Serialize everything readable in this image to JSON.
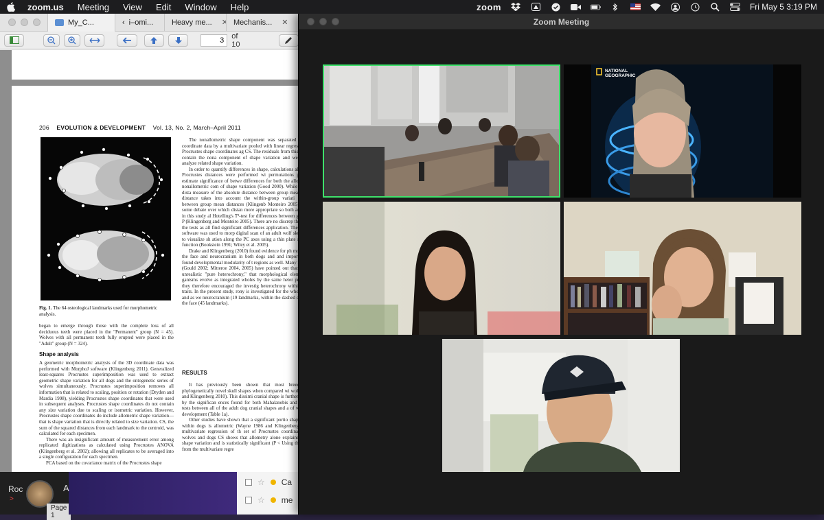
{
  "menubar": {
    "app": "zoom.us",
    "items": [
      "Meeting",
      "View",
      "Edit",
      "Window",
      "Help"
    ],
    "zoom_status": "zoom",
    "datetime": "Fri May 5  3:19 PM"
  },
  "pdf_viewer": {
    "tabs": [
      {
        "label": "My_C..."
      },
      {
        "label": "i–omi..."
      },
      {
        "label": "Heavy me..."
      },
      {
        "label": "Mechanis..."
      }
    ],
    "page_current": "3",
    "page_total_label": "of 10",
    "page": {
      "header_number": "206",
      "header_journal": "EVOLUTION & DEVELOPMENT",
      "header_issue": "Vol. 13, No. 2, March–April 2011",
      "figure_caption_bold": "Fig. 1.",
      "figure_caption": "The 64 osteological landmarks used for morphometric analysis.",
      "left_text_1": "began to emerge through those with the complete loss of all deciduous teeth were placed in the \"Permanent\" group (N = 45). Wolves with all permanent teeth fully erupted were placed in the \"Adult\" group (N = 324).",
      "section_shape": "Shape analysis",
      "left_text_2": "A geometric morphometric analysis of the 3D coordinate data was performed with MorphoJ software (Klingenberg 2011). Generalized least-squares Procrustes superimposition was used to extract geometric shape variation for all dogs and the ontogenetic series of wolves simultaneously. Procrustes superimposition removes all information that is related to scaling, position or rotation (Dryden and Mardia 1998), yielding Procrustes shape coordinates that were used in subsequent analyses. Procrustes shape coordinates do not contain any size variation due to scaling or isometric variation. However, Procrustes shape coordinates do include allometric shape variation—that is shape variation that is directly related to size variation. CS, the sum of the squared distances from each landmark to the centroid, was calculated for each specimen.",
      "left_text_3": "There was an insignificant amount of measurement error among replicated digitizations as calculated using Procrustes ANOVA (Klingenberg et al. 2002); allowing all replicates to be averaged into a single configuration for each specimen.",
      "left_text_4": "PCA based on the covariance matrix of the Procrustes shape",
      "right_text_1": "The nonallometric shape component was separated Procrustes coordinate data by a multivariate pooled with linear regression of the Procrustes shape coordinates ag CS. The residuals from this regression contain the nona component of shape variation and were used to analyze related shape variation.",
      "right_text_2": "In order to quantify differences in shape, calculations alanobis and Procrustes distances were performed wi permutations per test to estimate significance of betwe differences for both the allometric and nonallometric com of shape variation (Good 2000). While Procrustes dista measure of the absolute distance between group means, M obis distance takes into account the within-group variati calculating between group mean distances (Klingenb Monteiro 2005). There is some debate over which distan more appropriate so both are included in this study al Hotelling's T²-test for differences between group mean P (Klingenberg and Monteiro 2005). There are no discrep the results of the tests as all find significant differences application. The Landmark software was used to morp digital scan of an adult wolf skull in order to visualize sh ation along the PC axes using a thin plate spline inter function (Bookstein 1991; Wiley et al. 2005).",
      "right_text_3": "Drake and Klingenberg (2010) found evidence for ph modularity of the face and neurocranium in both dogs and and importantly they found developmental modularity of t regions as well. Many researchers (Gould 2002; Mitteroe 2004, 2005) have pointed out that it may be unrealistic \"pure heterochrony,\" that morphological elements of e ganisms evolve as integrated wholes by the same heter process, and they therefore encouraged the investig heterochrony within suites of traits. In the present study, rony is investigated for the whole cranium and as we neurocranium (19 landmarks, within the dashed circle o and the face (45 landmarks).",
      "results_head": "RESULTS",
      "right_text_4": "It has previously been shown that most breeds of do phylogenetically novel skull shapes when compared wi wolves (Drake and Klingenberg 2010). This dissimi cranial shape is further confirmed by the significan ences found for both Mahalanobis and Procrustes tests between all of the adult dog cranial shapes and a of wolf cranial development (Table 1a).",
      "right_text_5": "Other studies have shown that a significant portio shape variation within dogs is allometric (Wayne 1986 and Klingenberg 2010). A multivariate regression of th set of Procrustes coordinates for all wolves and dogs CS shows that allometry alone explains 33.8% of shape variation and is statistically significant (P < Using the residuals from the multivariate regre"
    }
  },
  "background": {
    "left_label": "Roc",
    "left_sub": "A",
    "page_label": "Page 1",
    "list_items": [
      "Ca",
      "me"
    ]
  },
  "zoom": {
    "title": "Zoom Meeting",
    "tiles": [
      {
        "id": "conference-room",
        "speaking": true
      },
      {
        "id": "participant-ng",
        "badge": "NATIONAL GEOGRAPHIC"
      },
      {
        "id": "participant-blurred"
      },
      {
        "id": "participant-bookshelf"
      },
      {
        "id": "participant-cap"
      }
    ]
  }
}
